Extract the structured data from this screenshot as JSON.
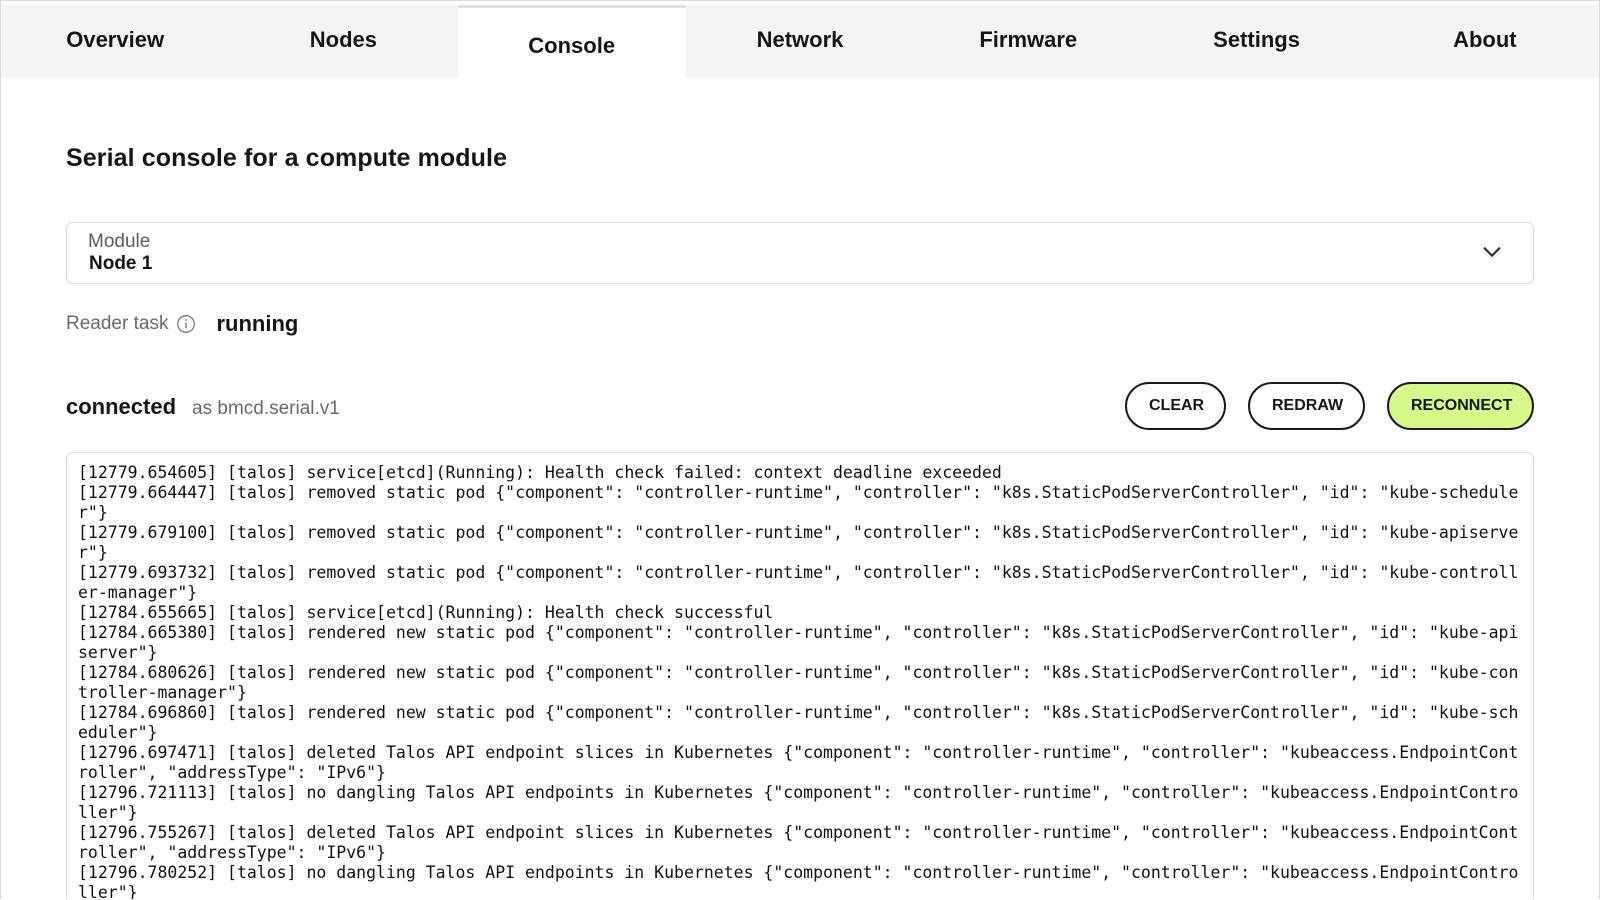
{
  "tabs": [
    {
      "label": "Overview",
      "active": false
    },
    {
      "label": "Nodes",
      "active": false
    },
    {
      "label": "Console",
      "active": true
    },
    {
      "label": "Network",
      "active": false
    },
    {
      "label": "Firmware",
      "active": false
    },
    {
      "label": "Settings",
      "active": false
    },
    {
      "label": "About",
      "active": false
    }
  ],
  "page": {
    "title": "Serial console for a compute module"
  },
  "module_select": {
    "label": "Module",
    "value": "Node 1",
    "icon": "chevron-down-icon"
  },
  "reader": {
    "label": "Reader task",
    "icon": "info-icon",
    "value": "running"
  },
  "connection": {
    "status": "connected",
    "protocol": "as bmcd.serial.v1"
  },
  "actions": {
    "clear_label": "CLEAR",
    "redraw_label": "REDRAW",
    "reconnect_label": "RECONNECT",
    "reconnect_color": "#d6f88a"
  },
  "console": {
    "lines": [
      "[12779.654605] [talos] service[etcd](Running): Health check failed: context deadline exceeded",
      "[12779.664447] [talos] removed static pod {\"component\": \"controller-runtime\", \"controller\": \"k8s.StaticPodServerController\", \"id\": \"kube-scheduler\"}",
      "[12779.679100] [talos] removed static pod {\"component\": \"controller-runtime\", \"controller\": \"k8s.StaticPodServerController\", \"id\": \"kube-apiserver\"}",
      "[12779.693732] [talos] removed static pod {\"component\": \"controller-runtime\", \"controller\": \"k8s.StaticPodServerController\", \"id\": \"kube-controller-manager\"}",
      "[12784.655665] [talos] service[etcd](Running): Health check successful",
      "[12784.665380] [talos] rendered new static pod {\"component\": \"controller-runtime\", \"controller\": \"k8s.StaticPodServerController\", \"id\": \"kube-apiserver\"}",
      "[12784.680626] [talos] rendered new static pod {\"component\": \"controller-runtime\", \"controller\": \"k8s.StaticPodServerController\", \"id\": \"kube-controller-manager\"}",
      "[12784.696860] [talos] rendered new static pod {\"component\": \"controller-runtime\", \"controller\": \"k8s.StaticPodServerController\", \"id\": \"kube-scheduler\"}",
      "[12796.697471] [talos] deleted Talos API endpoint slices in Kubernetes {\"component\": \"controller-runtime\", \"controller\": \"kubeaccess.EndpointController\", \"addressType\": \"IPv6\"}",
      "[12796.721113] [talos] no dangling Talos API endpoints in Kubernetes {\"component\": \"controller-runtime\", \"controller\": \"kubeaccess.EndpointController\"}",
      "[12796.755267] [talos] deleted Talos API endpoint slices in Kubernetes {\"component\": \"controller-runtime\", \"controller\": \"kubeaccess.EndpointController\", \"addressType\": \"IPv6\"}",
      "[12796.780252] [talos] no dangling Talos API endpoints in Kubernetes {\"component\": \"controller-runtime\", \"controller\": \"kubeaccess.EndpointController\"}"
    ]
  }
}
